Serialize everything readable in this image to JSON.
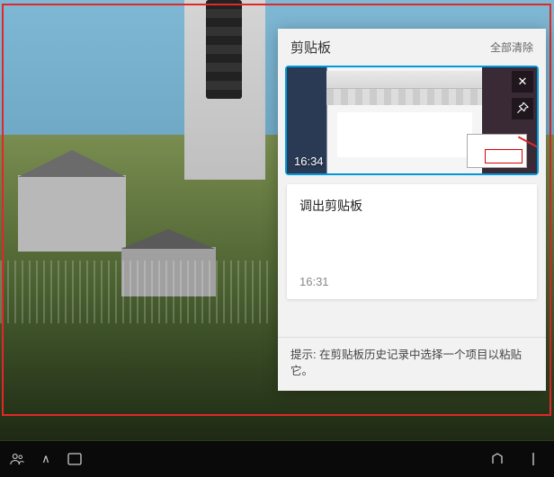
{
  "clipboard": {
    "title": "剪贴板",
    "clear_all_label": "全部清除",
    "items": [
      {
        "type": "image",
        "time": "16:34",
        "selected": true
      },
      {
        "type": "text",
        "content": "调出剪贴板",
        "time": "16:31",
        "selected": false
      }
    ],
    "tip": "提示: 在剪贴板历史记录中选择一个项目以粘贴它。"
  },
  "icons": {
    "close": "✕",
    "pin": "📌",
    "people": "👥",
    "chevron_up": "∧",
    "ime": "▭"
  }
}
